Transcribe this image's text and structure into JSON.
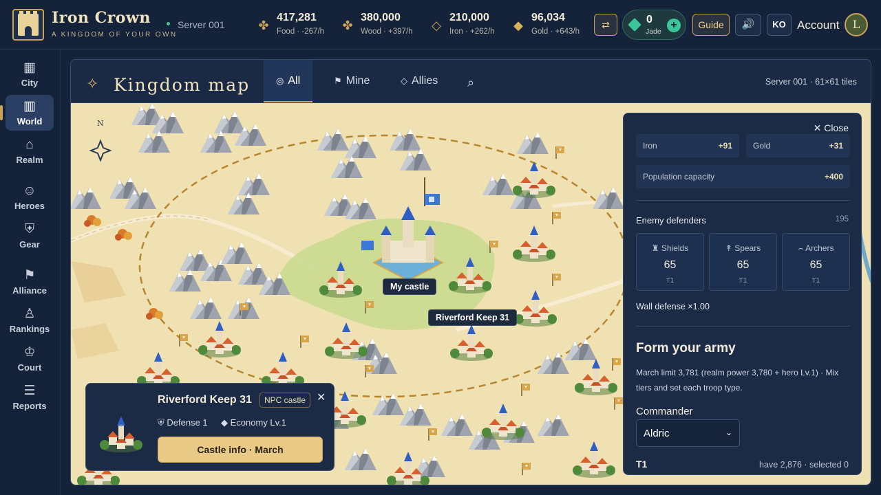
{
  "brand": {
    "title": "Iron Crown",
    "subtitle": "A KINGDOM OF YOUR OWN",
    "server": "Server 001"
  },
  "resources": [
    {
      "icon": "wheat-icon",
      "value": "417,281",
      "label": "Food · -267/h"
    },
    {
      "icon": "wood-icon",
      "value": "380,000",
      "label": "Wood · +397/h"
    },
    {
      "icon": "iron-icon",
      "value": "210,000",
      "label": "Iron · +262/h"
    },
    {
      "icon": "gold-icon",
      "value": "96,034",
      "label": "Gold · +643/h"
    }
  ],
  "header": {
    "swap_icon": "⇄",
    "jade_value": "0",
    "jade_label": "Jade",
    "jade_plus": "+",
    "guide_label": "Guide",
    "sound_icon": "🔊",
    "lang_label": "KO",
    "account_label": "Account",
    "avatar_initial": "L"
  },
  "sidebar": {
    "items": [
      {
        "label": "City",
        "icon": "city-icon",
        "glyph": "▦"
      },
      {
        "label": "World",
        "icon": "map-icon",
        "glyph": "▥"
      },
      {
        "label": "Realm",
        "icon": "bank-icon",
        "glyph": "⌂"
      },
      {
        "label": "Heroes",
        "icon": "hero-icon",
        "glyph": "☺"
      },
      {
        "label": "Gear",
        "icon": "shield-icon",
        "glyph": "⛨"
      },
      {
        "label": "Alliance",
        "icon": "flag-icon",
        "glyph": "⚑"
      },
      {
        "label": "Rankings",
        "icon": "rankings-icon",
        "glyph": "♙"
      },
      {
        "label": "Court",
        "icon": "crown-icon",
        "glyph": "♔"
      },
      {
        "label": "Reports",
        "icon": "reports-icon",
        "glyph": "☰"
      }
    ],
    "active": "World"
  },
  "map_panel": {
    "title": "Kingdom map",
    "tabs": [
      {
        "label": "All",
        "glyph": "◎"
      },
      {
        "label": "Mine",
        "glyph": "⚑"
      },
      {
        "label": "Allies",
        "glyph": "◇"
      }
    ],
    "active_tab": "All",
    "tile_info": "Server 001 · 61×61 tiles",
    "compass_label": "N"
  },
  "map_labels": {
    "my_castle": "My castle",
    "selected_castle": "Riverford Keep 31"
  },
  "popup": {
    "name": "Riverford Keep 31",
    "tag": "NPC castle",
    "defense": "Defense 1",
    "economy": "Economy Lv.1",
    "button": "Castle info · March"
  },
  "side_panel": {
    "close_label": "Close",
    "bonuses": [
      {
        "key": "Iron",
        "value": "+91"
      },
      {
        "key": "Gold",
        "value": "+31"
      },
      {
        "key": "Population capacity",
        "value": "+400"
      }
    ],
    "defenders_label": "Enemy defenders",
    "defenders_total": "195",
    "troops": [
      {
        "name": "Shields",
        "glyph": "♜",
        "count": "65",
        "tier": "T1"
      },
      {
        "name": "Spears",
        "glyph": "↟",
        "count": "65",
        "tier": "T1"
      },
      {
        "name": "Archers",
        "glyph": "⌢",
        "count": "65",
        "tier": "T1"
      }
    ],
    "wall_defense": "Wall defense ×1.00",
    "army_title": "Form your army",
    "army_desc": "March limit 3,781 (realm power 3,780 + hero Lv.1) · Mix tiers and set each troop type.",
    "commander_label": "Commander",
    "commander_value": "Aldric",
    "tier_label": "T1",
    "tier_have": "have 2,876 · selected 0"
  },
  "colors": {
    "accent": "#c9a35a",
    "panel": "#1b2a45",
    "map_ground": "#efe1b1",
    "jade": "#3cc49a"
  }
}
